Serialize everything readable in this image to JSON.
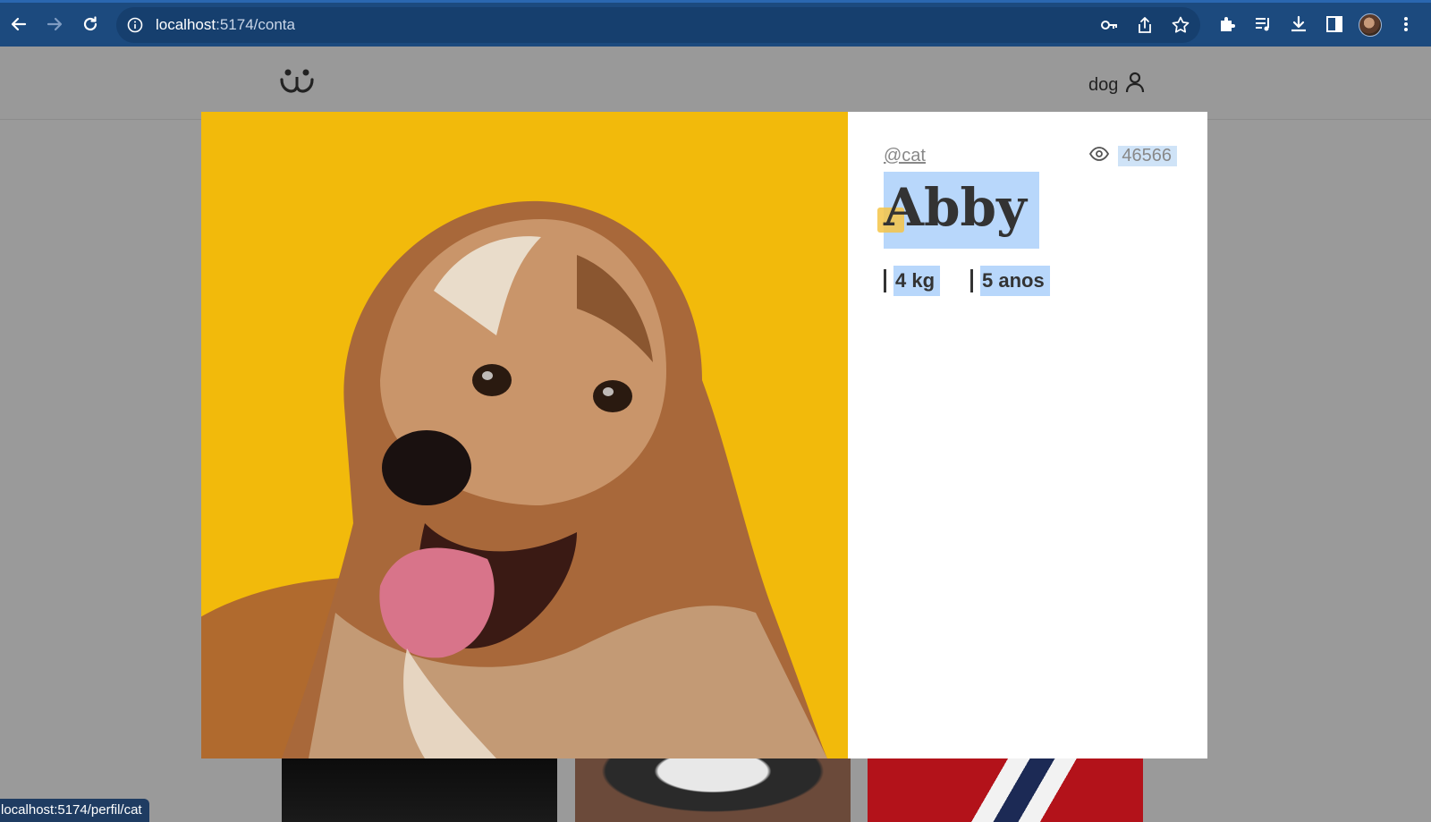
{
  "browser": {
    "url_host": "localhost",
    "url_path": ":5174/conta",
    "status_url": "localhost:5174/perfil/cat"
  },
  "header": {
    "account_label": "dog"
  },
  "photo_modal": {
    "author": "@cat",
    "views": "46566",
    "title": "Abby",
    "weight": "4 kg",
    "age": "5 anos"
  },
  "colors": {
    "chrome": "#1c4a7e",
    "photo_background": "#f1b90a",
    "selection": "#b8d7fb",
    "overlay": "#9a9a9a"
  }
}
